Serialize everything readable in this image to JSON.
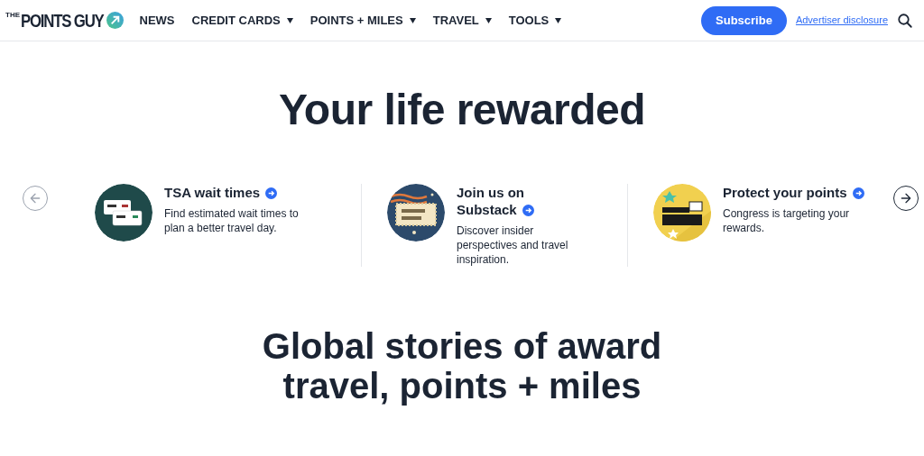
{
  "header": {
    "logo": {
      "prefix": "THE",
      "name": "POINTS GUY"
    },
    "nav": [
      {
        "label": "NEWS",
        "has_menu": false
      },
      {
        "label": "CREDIT CARDS",
        "has_menu": true
      },
      {
        "label": "POINTS + MILES",
        "has_menu": true
      },
      {
        "label": "TRAVEL",
        "has_menu": true
      },
      {
        "label": "TOOLS",
        "has_menu": true
      }
    ],
    "subscribe": "Subscribe",
    "disclosure": "Advertiser disclosure"
  },
  "hero": {
    "title": "Your life rewarded"
  },
  "carousel": {
    "prev": {
      "disabled": true
    },
    "next": {
      "disabled": false
    },
    "cards": [
      {
        "kind": "tsa",
        "title": "TSA wait times",
        "text": "Find estimated wait times to plan a better travel day."
      },
      {
        "kind": "substack",
        "title": "Join us on Substack",
        "text": "Discover insider perspectives and travel inspiration."
      },
      {
        "kind": "protect",
        "title": "Protect your points",
        "text": "Congress is targeting your rewards."
      }
    ]
  },
  "section": {
    "title": "Global stories of award travel, points + miles"
  }
}
